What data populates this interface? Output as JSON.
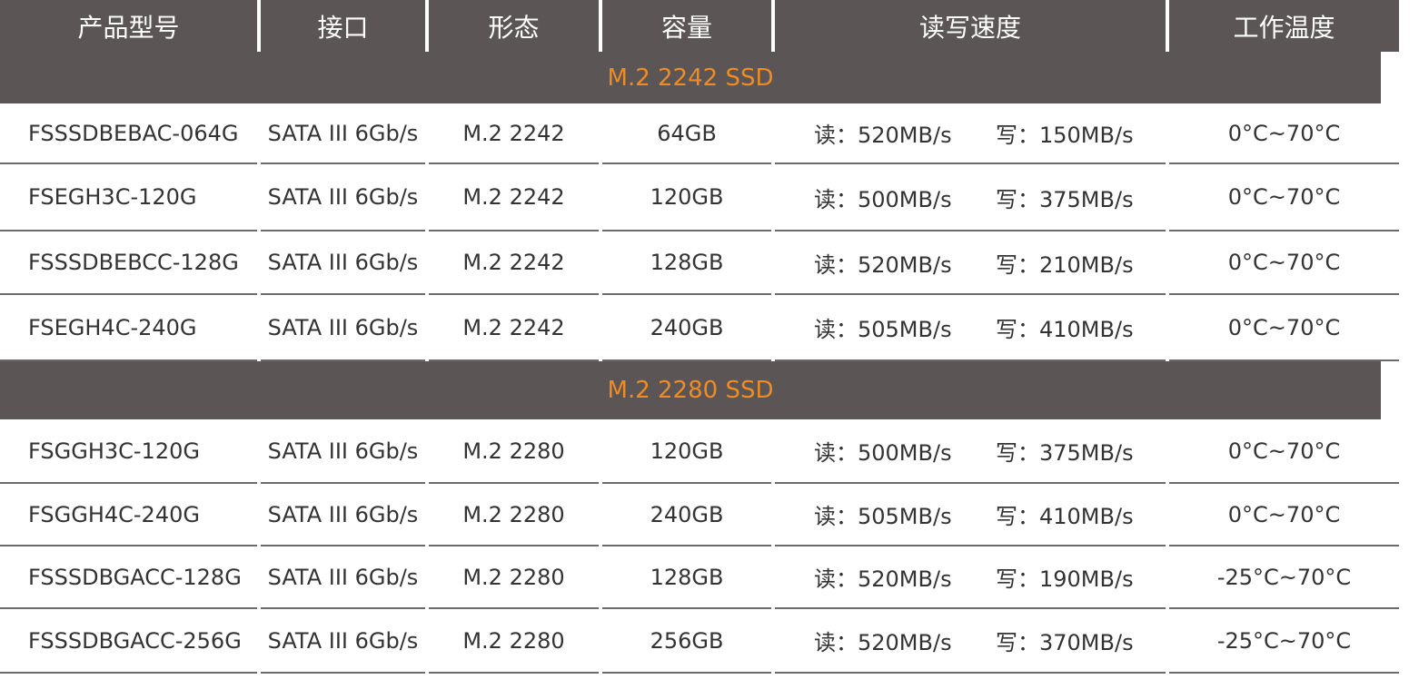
{
  "header": [
    "产品型号",
    "接口",
    "形态",
    "容量",
    "读写速度",
    "工作温度"
  ],
  "read_prefix": "读：",
  "write_prefix": "写：",
  "sections": [
    {
      "title": "M.2 2242 SSD",
      "rows": [
        {
          "model": "FSSSDBEBAC-064G",
          "interface": "SATA III 6Gb/s",
          "form": "M.2 2242",
          "capacity": "64GB",
          "read": "520MB/s",
          "write": "150MB/s",
          "temp": "0°C~70°C"
        },
        {
          "model": "FSEGH3C-120G",
          "interface": "SATA III 6Gb/s",
          "form": "M.2 2242",
          "capacity": "120GB",
          "read": "500MB/s",
          "write": "375MB/s",
          "temp": "0°C~70°C"
        },
        {
          "model": "FSSSDBEBCC-128G",
          "interface": "SATA III 6Gb/s",
          "form": "M.2 2242",
          "capacity": "128GB",
          "read": "520MB/s",
          "write": "210MB/s",
          "temp": "0°C~70°C"
        },
        {
          "model": "FSEGH4C-240G",
          "interface": "SATA III 6Gb/s",
          "form": "M.2 2242",
          "capacity": "240GB",
          "read": "505MB/s",
          "write": "410MB/s",
          "temp": "0°C~70°C"
        }
      ]
    },
    {
      "title": "M.2 2280 SSD",
      "rows": [
        {
          "model": "FSGGH3C-120G",
          "interface": "SATA III 6Gb/s",
          "form": "M.2 2280",
          "capacity": "120GB",
          "read": "500MB/s",
          "write": "375MB/s",
          "temp": "0°C~70°C"
        },
        {
          "model": "FSGGH4C-240G",
          "interface": "SATA III 6Gb/s",
          "form": "M.2 2280",
          "capacity": "240GB",
          "read": "505MB/s",
          "write": "410MB/s",
          "temp": "0°C~70°C"
        },
        {
          "model": "FSSSDBGACC-128G",
          "interface": "SATA III 6Gb/s",
          "form": "M.2 2280",
          "capacity": "128GB",
          "read": "520MB/s",
          "write": "190MB/s",
          "temp": "-25°C~70°C"
        },
        {
          "model": "FSSSDBGACC-256G",
          "interface": "SATA III 6Gb/s",
          "form": "M.2 2280",
          "capacity": "256GB",
          "read": "520MB/s",
          "write": "370MB/s",
          "temp": "-25°C~70°C"
        }
      ]
    }
  ],
  "colors": {
    "header_bg": "#5b5655",
    "header_text": "#ffffff",
    "section_text": "#f08b23",
    "body_text": "#333333",
    "divider": "#6d6968"
  }
}
